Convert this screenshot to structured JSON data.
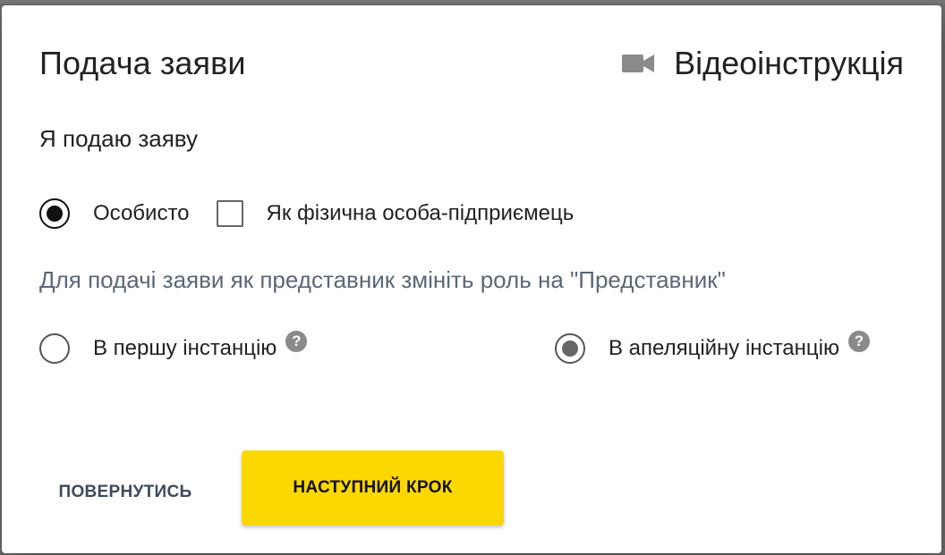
{
  "dialog": {
    "title": "Подача заяви",
    "video_link_label": "Відеоінструкція",
    "video_icon": "videocam-icon",
    "subheading": "Я подаю заяву",
    "applicant_options": {
      "personal": {
        "label": "Особисто",
        "selected": true
      },
      "entrepreneur": {
        "label": "Як фізична особа-підприємець",
        "checked": false
      }
    },
    "note": "Для подачі заяви як представник змініть роль на \"Представник\"",
    "instance_options": {
      "first": {
        "label": "В першу інстанцію",
        "selected": false,
        "help_icon": "?"
      },
      "appeal": {
        "label": "В апеляційну інстанцію",
        "selected": true,
        "help_icon": "?"
      }
    },
    "buttons": {
      "back_label": "ПОВЕРНУТИСЬ",
      "next_label": "НАСТУПНИЙ КРОК"
    },
    "colors": {
      "accent_yellow": "#fdd800",
      "note_text": "#5b6777",
      "back_text": "#3d4a5c"
    }
  }
}
